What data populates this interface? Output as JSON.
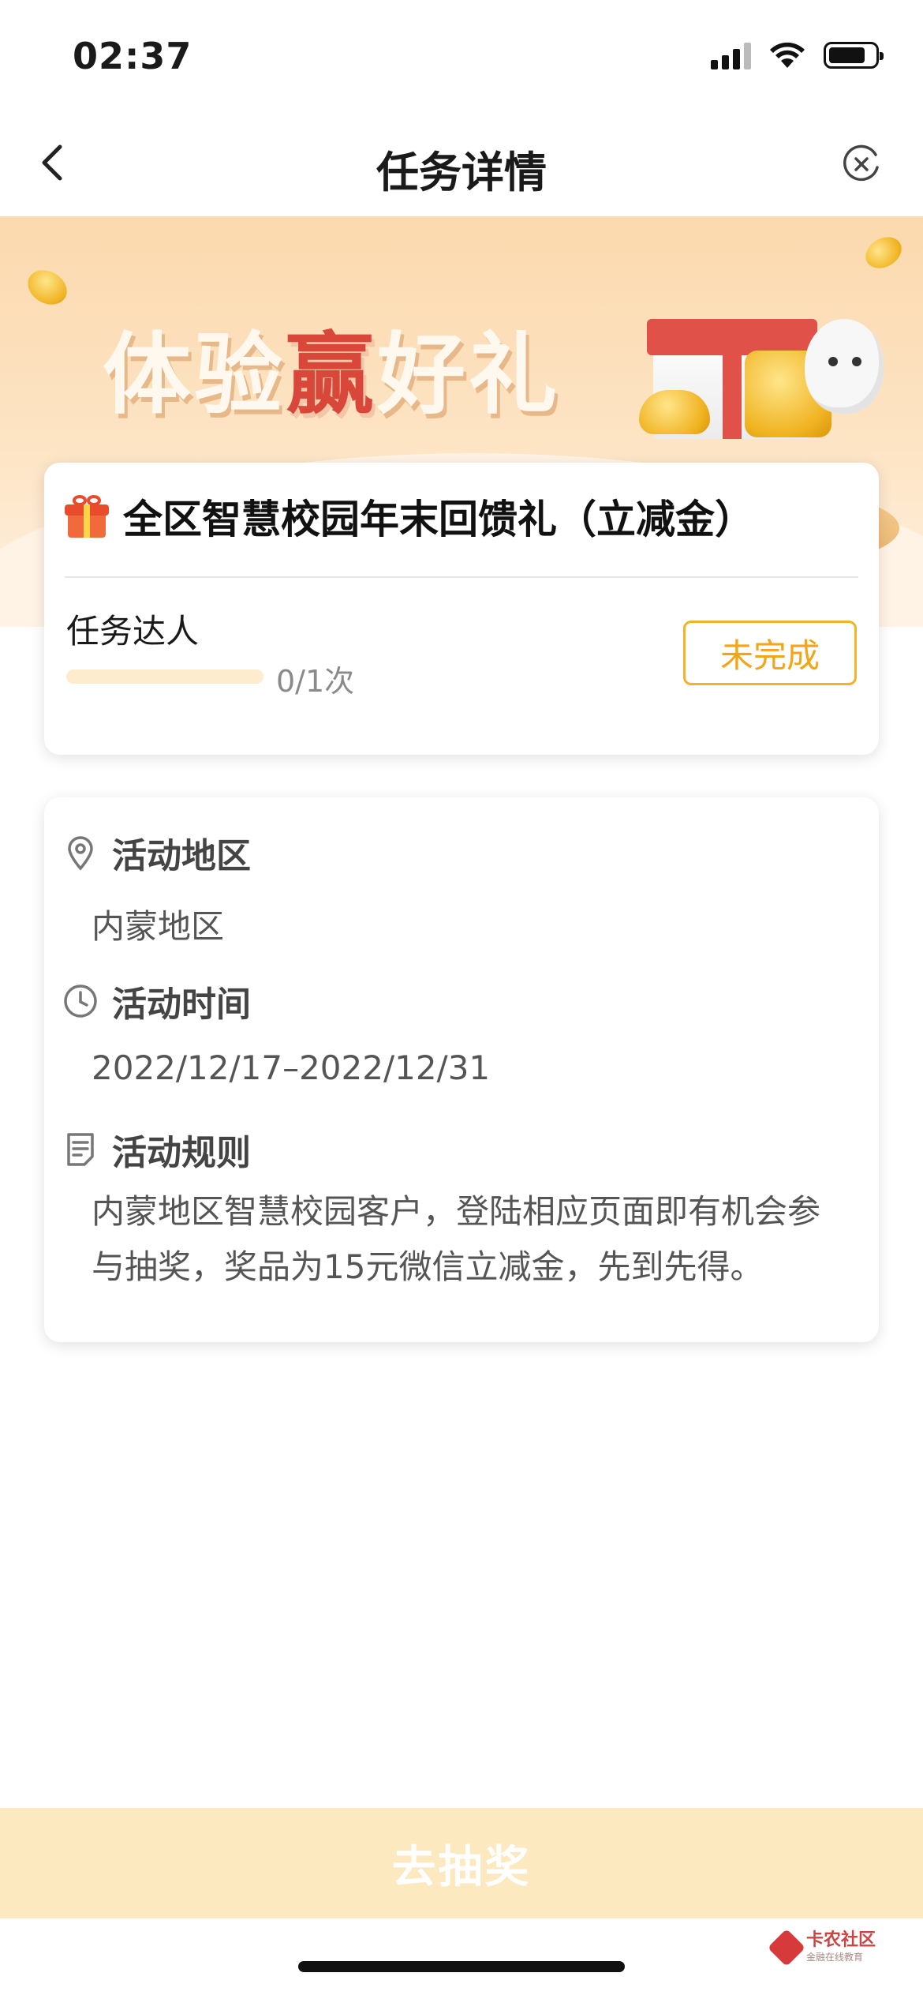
{
  "status_bar": {
    "time": "02:37",
    "battery_level": 0.8
  },
  "nav": {
    "title": "任务详情",
    "back_icon": "chevron-left-icon",
    "close_icon": "close-circle-icon"
  },
  "banner": {
    "title_part1": "体验",
    "title_highlight": "赢",
    "title_part2": "好礼",
    "highlight_color": "#d8473a"
  },
  "task": {
    "title": "全区智慧校园年末回馈礼（立减金）",
    "name": "任务达人",
    "progress_text": "0/1次",
    "progress_current": 0,
    "progress_total": 1,
    "status_label": "未完成",
    "accent_color": "#f3b324"
  },
  "info": {
    "region_label": "活动地区",
    "region_value": "内蒙地区",
    "time_label": "活动时间",
    "time_value": "2022/12/17–2022/12/31",
    "rules_label": "活动规则",
    "rules_value": "内蒙地区智慧校园客户，登陆相应页面即有机会参与抽奖，奖品为15元微信立减金，先到先得。"
  },
  "bottom": {
    "action_label": "去抽奖"
  },
  "watermark": {
    "name": "卡农社区",
    "sub": "金融在线教育"
  }
}
